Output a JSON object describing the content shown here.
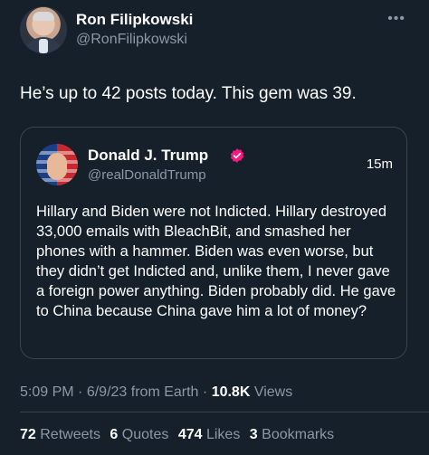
{
  "author": {
    "name": "Ron Filipkowski",
    "handle": "@RonFilipkowski"
  },
  "tweet_text": "He’s up to 42 posts today. This gem was 39.",
  "quoted": {
    "name": "Donald J. Trump",
    "handle": "@realDonaldTrump",
    "time": "15m",
    "text": "Hillary and Biden were not Indicted. Hillary destroyed 33,000 emails with BleachBit, and smashed her phones with a hammer. Biden was even worse, but they didn’t get Indicted and, unlike them, I never gave a foreign power anything. Biden probably did. He gave to China because China gave him a lot of money?"
  },
  "meta": {
    "time": "5:09 PM",
    "date": "6/9/23",
    "source": "from Earth",
    "views_count": "10.8K",
    "views_label": "Views"
  },
  "stats": {
    "retweets_count": "72",
    "retweets_label": "Retweets",
    "quotes_count": "6",
    "quotes_label": "Quotes",
    "likes_count": "474",
    "likes_label": "Likes",
    "bookmarks_count": "3",
    "bookmarks_label": "Bookmarks"
  },
  "icons": {
    "more": "more-options-icon",
    "verified": "verified-badge-icon"
  },
  "colors": {
    "background": "#15202b",
    "secondary_text": "#8b98a5",
    "border": "#38444d",
    "verified": "#f91880"
  }
}
